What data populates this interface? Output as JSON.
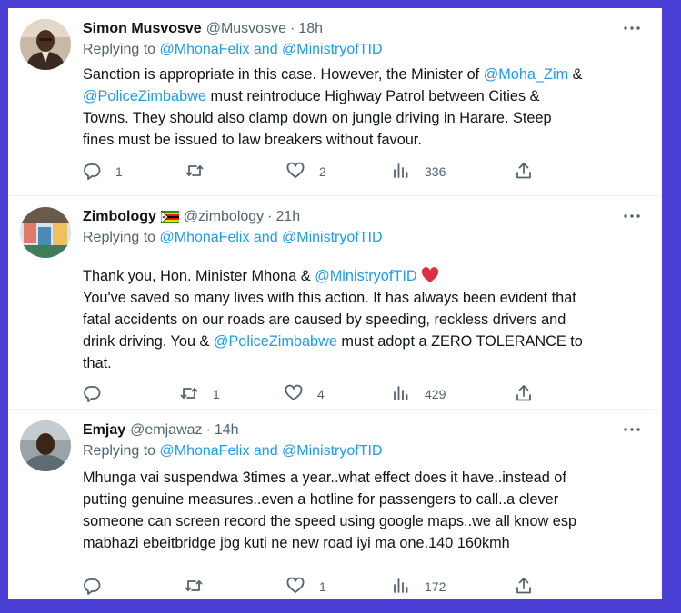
{
  "colors": {
    "background": "#4b3fd6",
    "link": "#1d9bf0",
    "muted": "#536471",
    "text": "#0f1419"
  },
  "tweets": [
    {
      "name": "Simon Musvosve",
      "handle": "@Musvosve",
      "sep": "·",
      "time": "18h",
      "reply_prefix": "Replying to ",
      "reply_to": "@MhonaFelix and @MinistryofTID",
      "lines": [
        [
          "Sanction is appropriate in this case. However, the Minister of ",
          {
            "link": "@Moha_Zim"
          },
          " &"
        ],
        [
          {
            "link": "@PoliceZimbabwe"
          },
          " must reintroduce Highway Patrol between Cities &"
        ],
        [
          "Towns. They should also clamp down on jungle driving in Harare. Steep"
        ],
        [
          "fines must be issued to law breakers without favour."
        ]
      ],
      "replies": "1",
      "retweets": "",
      "likes": "2",
      "views": "336"
    },
    {
      "name": "Zimbology",
      "handle": "@zimbology",
      "sep": "·",
      "time": "21h",
      "reply_prefix": "Replying to ",
      "reply_to": "@MhonaFelix and @MinistryofTID",
      "lines": [
        [
          "Thank you, Hon. Minister Mhona & ",
          {
            "link": "@MinistryofTID"
          },
          " ",
          {
            "heart": true
          }
        ],
        [
          "You've saved so many lives with this action. It has always been evident that"
        ],
        [
          "fatal accidents on our roads are caused by speeding, reckless drivers and"
        ],
        [
          "drink driving. You & ",
          {
            "link": "@PoliceZimbabwe"
          },
          " must adopt a ZERO TOLERANCE to"
        ],
        [
          "that."
        ]
      ],
      "replies": "",
      "retweets": "1",
      "likes": "4",
      "views": "429"
    },
    {
      "name": "Emjay",
      "handle": "@emjawaz",
      "sep": "·",
      "time": "14h",
      "reply_prefix": "Replying to ",
      "reply_to": "@MhonaFelix and @MinistryofTID",
      "lines": [
        [
          "Mhunga vai suspendwa 3times a year..what effect does it have..instead of"
        ],
        [
          "putting genuine measures..even a hotline for passengers to call..a clever"
        ],
        [
          "someone can screen record the speed using google maps..we all know esp"
        ],
        [
          "mabhazi ebeitbridge jbg kuti ne new road iyi ma one.140 160kmh"
        ]
      ],
      "replies": "",
      "retweets": "",
      "likes": "1",
      "views": "172"
    }
  ]
}
